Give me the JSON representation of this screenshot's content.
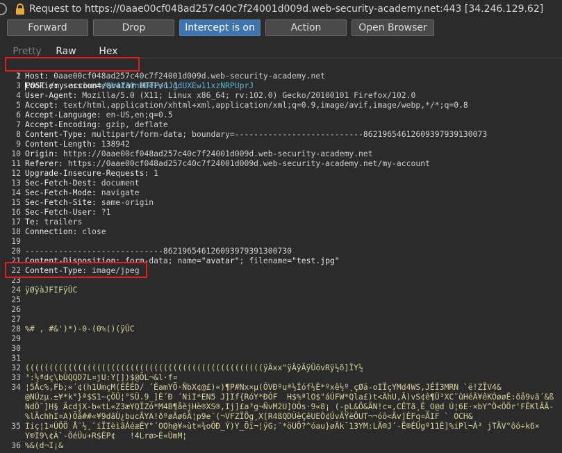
{
  "window": {
    "title": "Request to https://0aae00cf048ad257c40c7f24001d009d.web-security-academy.net:443  [34.246.129.62]"
  },
  "toolbar": {
    "forward": "Forward",
    "drop": "Drop",
    "intercept": "Intercept is on",
    "action": "Action",
    "open_browser": "Open Browser"
  },
  "tabs": {
    "pretty": "Pretty",
    "raw": "Raw",
    "hex": "Hex"
  },
  "request": {
    "l1": {
      "num": "1",
      "method": "POST /my-account/avatar",
      "rest": " HTTP/1.1"
    },
    "l2": {
      "num": "2",
      "name": "Host:",
      "val": " 0aae00cf048ad257c40c7f24001d009d.web-security-academy.net"
    },
    "l3": {
      "num": "3",
      "name": "Cookie:",
      "val": " session=",
      "tok": "eQb4Z3QnDDeFooJgdUXEw11xzNRPUprJ"
    },
    "l4": {
      "num": "4",
      "name": "User-Agent:",
      "val": " Mozilla/5.0 (X11; Linux x86_64; rv:102.0) Gecko/20100101 Firefox/102.0"
    },
    "l5": {
      "num": "5",
      "name": "Accept:",
      "val": " text/html,application/xhtml+xml,application/xml;q=0.9,image/avif,image/webp,*/*;q=0.8"
    },
    "l6": {
      "num": "6",
      "name": "Accept-Language:",
      "val": " en-US,en;q=0.5"
    },
    "l7": {
      "num": "7",
      "name": "Accept-Encoding:",
      "val": " gzip, deflate"
    },
    "l8": {
      "num": "8",
      "name": "Content-Type:",
      "val": " multipart/form-data; boundary=---------------------------86219654612609397939130073"
    },
    "l9": {
      "num": "9",
      "name": "Content-Length:",
      "val": " 138942"
    },
    "l10": {
      "num": "10",
      "name": "Origin:",
      "val": " https://0aae00cf048ad257c40c7f24001d009d.web-security-academy.net"
    },
    "l11": {
      "num": "11",
      "name": "Referer:",
      "val": " https://0aae00cf048ad257c40c7f24001d009d.web-security-academy.net/my-account"
    },
    "l12": {
      "num": "12",
      "name": "Upgrade-Insecure-Requests:",
      "val": " 1"
    },
    "l13": {
      "num": "13",
      "name": "Sec-Fetch-Dest:",
      "val": " document"
    },
    "l14": {
      "num": "14",
      "name": "Sec-Fetch-Mode:",
      "val": " navigate"
    },
    "l15": {
      "num": "15",
      "name": "Sec-Fetch-Site:",
      "val": " same-origin"
    },
    "l16": {
      "num": "16",
      "name": "Sec-Fetch-User:",
      "val": " ?1"
    },
    "l17": {
      "num": "17",
      "name": "Te:",
      "val": " trailers"
    },
    "l18": {
      "num": "18",
      "name": "Connection:",
      "val": " close"
    },
    "l19": {
      "num": "19"
    },
    "l20": {
      "num": "20",
      "text": "-----------------------------862196546126093979391300730"
    },
    "l21": {
      "num": "21",
      "name": "Content-Disposition:",
      "val1": " form-data; name=",
      "q1": "\"avatar\"",
      "val2": "; filename=",
      "q2": "\"test.jpg\""
    },
    "l22": {
      "num": "22",
      "name": "Content-Type:",
      "val": " image/jpeg"
    },
    "l23": {
      "num": "23"
    },
    "l24": {
      "num": "24",
      "bin": "ÿØÿàJFIFÿÛC"
    },
    "l25": {
      "num": "25"
    },
    "l26": {
      "num": "26"
    },
    "l27": {
      "num": "27"
    },
    "l28": {
      "num": "28",
      "bin": "%# , #&')*)-0-(0%()(ÿÛC"
    },
    "l29": {
      "num": "29"
    },
    "l30": {
      "num": "30"
    },
    "l31": {
      "num": "31"
    },
    "l32": {
      "num": "32",
      "bin": "((((((((((((((((((((((((((((((((((((((((((((((((((ÿÄxx\"ÿÄÿÄÿÜövRÿ½õ]ÏY½"
    },
    "l33": {
      "num": "33",
      "bin": "³:½ªdç\\bÙQQD7L¤jU:Y[])$@ÕL¬&l·f¤"
    },
    "l34a": {
      "num": "34",
      "bin": "¦5Ãc%,Fb;«´¢(h1UmçM(ÉÉÉD/ ´ÈamYÕ·ÑbX¢@£)«)¶P#Nx×µ(ÓVÐºuª½Íóf½È*ºxê½º¸çØä-oIÏçYMd4WS,JÉÍ3MRN `ë!ZÏV4&"
    },
    "l34b": {
      "bin": "@NÚzµ.±¥*k°}ª$S1~çÕÛ¦°SÜ.9_]È´Ð ´NiI*EN5 J]If{RóY*ÐÓF  H$%ªlO$\"áÚFW*Qla£)t<ÄhU,Ã)vS¢ê¶Ü³XC¨ûHéÃ¥êKÓøøÊ:õå9vã´&ß"
    },
    "l34c": {
      "bin": "NdÖ¨]H§ ÄcdjX-b«tL«Z3æYQÏZó*M4B¶åèjHè®XS®,Ij]£a³g¬ÑvM2U]OÕs·9«8¡ (-pL&Ö&ÄN!c¤,CÊTã¸Ê_O@d Ú¦6E·×bY^Ö<ÖÖr'FÊKlÂÃ-"
    },
    "l34d": {
      "bin": "%lÄchhI¤A)Õå##«¥9dãÙ¿bucÃYA!ðºøÃø6Ä¦p9e¨(¬VFZÏÖg¸X[R4ßQDÙèÇêUEÒ¢ÚvÄŸëÖUT¬¬óô<Ãv]ÈFq¤ÃIF ` OCH&"
    },
    "l35a": {
      "num": "35",
      "bin": "Iiç¦1¤ÚÖÖ Å¨½¸¨íÏIèìãÁéæÉY°´OOh@¥»ùt¤¾oÓÐ_Ý)Y_Õï¬¦ÿG;¨*öUÖ?^óau}øÄk¯13YM:LÄ®J´-Ë®ÉÜgº11È]%iPl¬Á³ jTÄV°ôó÷k6×"
    },
    "l35b": {
      "bin": "Y®I9\\¢Á`-ÕéÜu+R$ÉP¢   !4Lrø>É«ÙmM¦"
    },
    "l36": {
      "num": "36",
      "bin": "%&(d¬I¡&"
    }
  }
}
